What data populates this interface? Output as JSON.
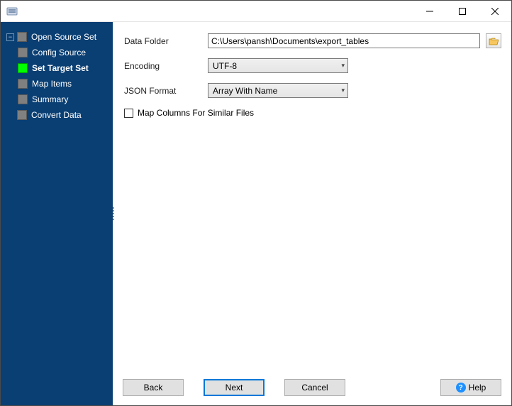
{
  "titlebar": {
    "title": ""
  },
  "sidebar": {
    "items": [
      {
        "label": "Open Source Set",
        "active": false,
        "children": [
          {
            "label": "Config Source",
            "active": false
          },
          {
            "label": "Set Target Set",
            "active": true
          },
          {
            "label": "Map Items",
            "active": false
          },
          {
            "label": "Summary",
            "active": false
          }
        ]
      },
      {
        "label": "Convert Data",
        "active": false
      }
    ]
  },
  "form": {
    "data_folder_label": "Data Folder",
    "data_folder_value": "C:\\Users\\pansh\\Documents\\export_tables",
    "encoding_label": "Encoding",
    "encoding_value": "UTF-8",
    "json_format_label": "JSON Format",
    "json_format_value": "Array With Name",
    "map_columns_label": "Map Columns For Similar Files",
    "map_columns_checked": false
  },
  "buttons": {
    "back": "Back",
    "next": "Next",
    "cancel": "Cancel",
    "help": "Help"
  }
}
